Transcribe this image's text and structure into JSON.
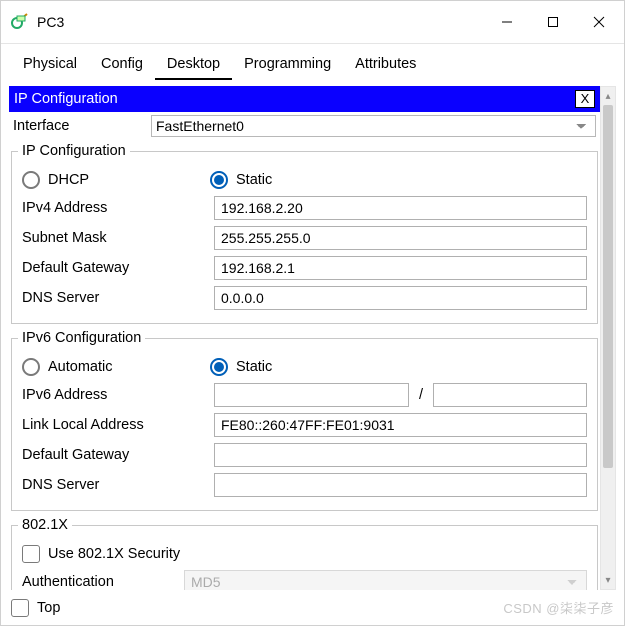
{
  "window": {
    "title": "PC3"
  },
  "tabs": [
    "Physical",
    "Config",
    "Desktop",
    "Programming",
    "Attributes"
  ],
  "active_tab": "Desktop",
  "panel": {
    "title": "IP Configuration",
    "close_label": "X"
  },
  "interface": {
    "label": "Interface",
    "value": "FastEthernet0"
  },
  "ipv4": {
    "legend": "IP Configuration",
    "dhcp_label": "DHCP",
    "static_label": "Static",
    "mode": "Static",
    "fields": {
      "ipv4_label": "IPv4 Address",
      "ipv4_value": "192.168.2.20",
      "subnet_label": "Subnet Mask",
      "subnet_value": "255.255.255.0",
      "gateway_label": "Default Gateway",
      "gateway_value": "192.168.2.1",
      "dns_label": "DNS Server",
      "dns_value": "0.0.0.0"
    }
  },
  "ipv6": {
    "legend": "IPv6 Configuration",
    "auto_label": "Automatic",
    "static_label": "Static",
    "mode": "Static",
    "fields": {
      "addr_label": "IPv6 Address",
      "addr_value": "",
      "prefix_value": "",
      "lla_label": "Link Local Address",
      "lla_value": "FE80::260:47FF:FE01:9031",
      "gateway_label": "Default Gateway",
      "gateway_value": "",
      "dns_label": "DNS Server",
      "dns_value": ""
    }
  },
  "dot1x": {
    "legend": "802.1X",
    "use_label": "Use 802.1X Security",
    "use_checked": false,
    "auth_label": "Authentication",
    "auth_value": "MD5"
  },
  "footer": {
    "top_label": "Top",
    "top_checked": false
  },
  "watermark": "CSDN @柒柒子彦"
}
